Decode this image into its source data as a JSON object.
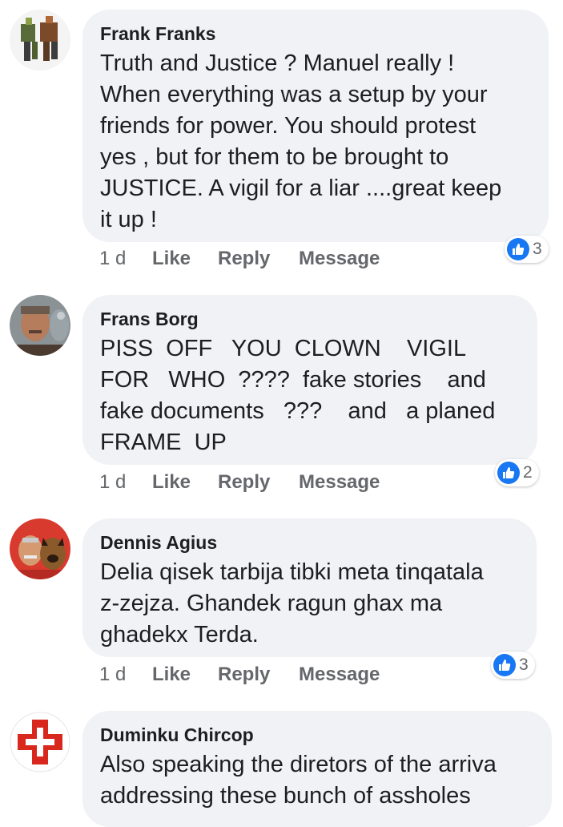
{
  "comments": [
    {
      "author": "Frank Franks",
      "text": "Truth and Justice ? Manuel really !\nWhen everything was a setup by your\nfriends for power. You should protest\nyes , but for them to be brought to\nJUSTICE. A vigil for a liar ....great keep\nit up !",
      "time": "1 d",
      "like_label": "Like",
      "reply_label": "Reply",
      "message_label": "Message",
      "reaction_count": "3",
      "avatar_icon": "robot-avatar-icon"
    },
    {
      "author": "Frans Borg",
      "text": "PISS  OFF   YOU  CLOWN    VIGIL\nFOR   WHO  ????  fake stories    and\nfake documents   ???    and   a planed\nFRAME  UP",
      "time": "1 d",
      "like_label": "Like",
      "reply_label": "Reply",
      "message_label": "Message",
      "reaction_count": "2",
      "avatar_icon": "man-with-parrot-avatar-icon"
    },
    {
      "author": "Dennis Agius",
      "text": "Delia qisek tarbija tibki meta tinqatala\nz-zejza. Ghandek ragun ghax ma\nghadekx Terda.",
      "time": "1 d",
      "like_label": "Like",
      "reply_label": "Reply",
      "message_label": "Message",
      "reaction_count": "3",
      "avatar_icon": "man-with-dog-avatar-icon"
    },
    {
      "author": "Duminku Chircop",
      "text": "Also speaking the diretors of the arriva\naddressing these bunch of assholes",
      "avatar_icon": "red-cross-avatar-icon"
    }
  ],
  "colors": {
    "bubble": "#f0f2f5",
    "action_text": "#65676b",
    "like_blue": "#1877f2",
    "name_text": "#1c1e21"
  }
}
